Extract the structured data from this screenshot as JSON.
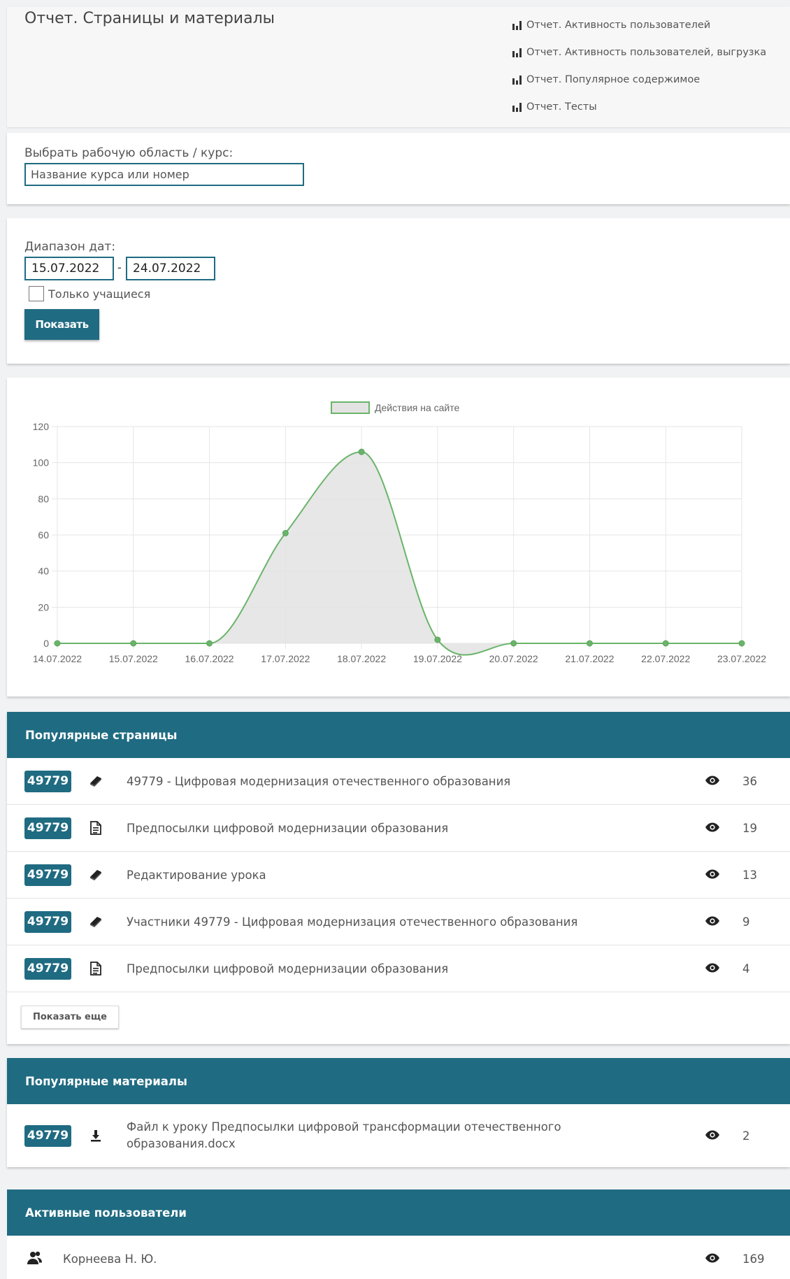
{
  "header": {
    "title": "Отчет. Страницы и материалы",
    "links": [
      "Отчет. Активность пользователей",
      "Отчет. Активность пользователей, выгрузка",
      "Отчет. Популярное содержимое",
      "Отчет. Тесты"
    ]
  },
  "course": {
    "label": "Выбрать рабочую область / курс:",
    "placeholder": "Название курса или номер"
  },
  "dates": {
    "label": "Диапазон дат:",
    "from": "15.07.2022",
    "to": "24.07.2022",
    "separator": "-",
    "only_students": "Только учащиеся",
    "show_button": "Показать"
  },
  "chart_data": {
    "type": "area",
    "series": [
      {
        "name": "Действия на сайте",
        "values": [
          0,
          0,
          0,
          61,
          106,
          2,
          0,
          0,
          0,
          0
        ]
      }
    ],
    "categories": [
      "14.07.2022",
      "15.07.2022",
      "16.07.2022",
      "17.07.2022",
      "18.07.2022",
      "19.07.2022",
      "20.07.2022",
      "21.07.2022",
      "22.07.2022",
      "23.07.2022"
    ],
    "yticks": [
      "0",
      "20",
      "40",
      "60",
      "80",
      "100",
      "120"
    ],
    "ylim": [
      0,
      120
    ],
    "grid": true,
    "legend": "top",
    "colors": {
      "line": "#6ab46a",
      "fill": "#e3e3e3",
      "grid": "#e6e6e6"
    }
  },
  "popular_pages": {
    "title": "Популярные страницы",
    "rows": [
      {
        "badge": "49779",
        "icon": "book-icon",
        "title": "49779 - Цифровая модернизация отечественного образования",
        "views": "36"
      },
      {
        "badge": "49779",
        "icon": "document-icon",
        "title": "Предпосылки цифровой модернизации образования",
        "views": "19"
      },
      {
        "badge": "49779",
        "icon": "book-icon",
        "title": "Редактирование урока",
        "views": "13"
      },
      {
        "badge": "49779",
        "icon": "book-icon",
        "title": "Участники 49779 - Цифровая модернизация отечественного образования",
        "views": "9"
      },
      {
        "badge": "49779",
        "icon": "document-icon",
        "title": "Предпосылки цифровой модернизации образования",
        "views": "4"
      }
    ],
    "more_button": "Показать еще"
  },
  "popular_materials": {
    "title": "Популярные материалы",
    "rows": [
      {
        "badge": "49779",
        "icon": "download-icon",
        "title_line1": "Файл к уроку Предпосылки цифровой трансформации отечественного",
        "title_line2": "образования.docx",
        "views": "2"
      }
    ]
  },
  "active_users": {
    "title": "Активные пользователи",
    "rows": [
      {
        "icon": "users-icon",
        "name": "Корнеева Н. Ю.",
        "views": "169"
      }
    ]
  }
}
